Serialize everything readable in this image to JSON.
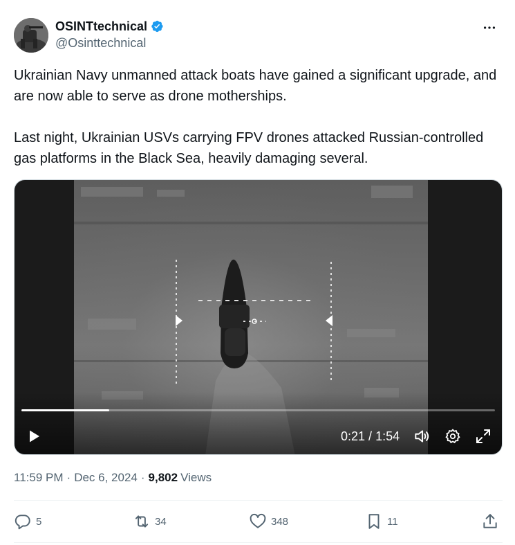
{
  "author": {
    "display_name": "OSINTtechnical",
    "handle": "@Osinttechnical",
    "verified": true,
    "verified_color": "#1d9bf0"
  },
  "tweet": {
    "paragraphs": [
      "Ukrainian Navy unmanned attack boats have gained a significant upgrade, and are now able to serve as drone motherships.",
      "Last night, Ukrainian USVs carrying FPV drones attacked Russian-controlled gas platforms in the Black Sea, heavily damaging several."
    ]
  },
  "video": {
    "current_time": "0:21",
    "separator": " / ",
    "duration": "1:54",
    "progress": 0.185,
    "icons": [
      "play-icon",
      "volume-icon",
      "settings-icon",
      "fullscreen-icon"
    ]
  },
  "meta": {
    "time": "11:59 PM",
    "dot": "·",
    "date": "Dec 6, 2024",
    "views_count": "9,802",
    "views_label": "Views"
  },
  "actions": {
    "replies": "5",
    "reposts": "34",
    "likes": "348",
    "bookmarks": "11"
  },
  "colors": {
    "text_primary": "#0f1419",
    "text_secondary": "#536471",
    "divider": "#eff3f4"
  }
}
